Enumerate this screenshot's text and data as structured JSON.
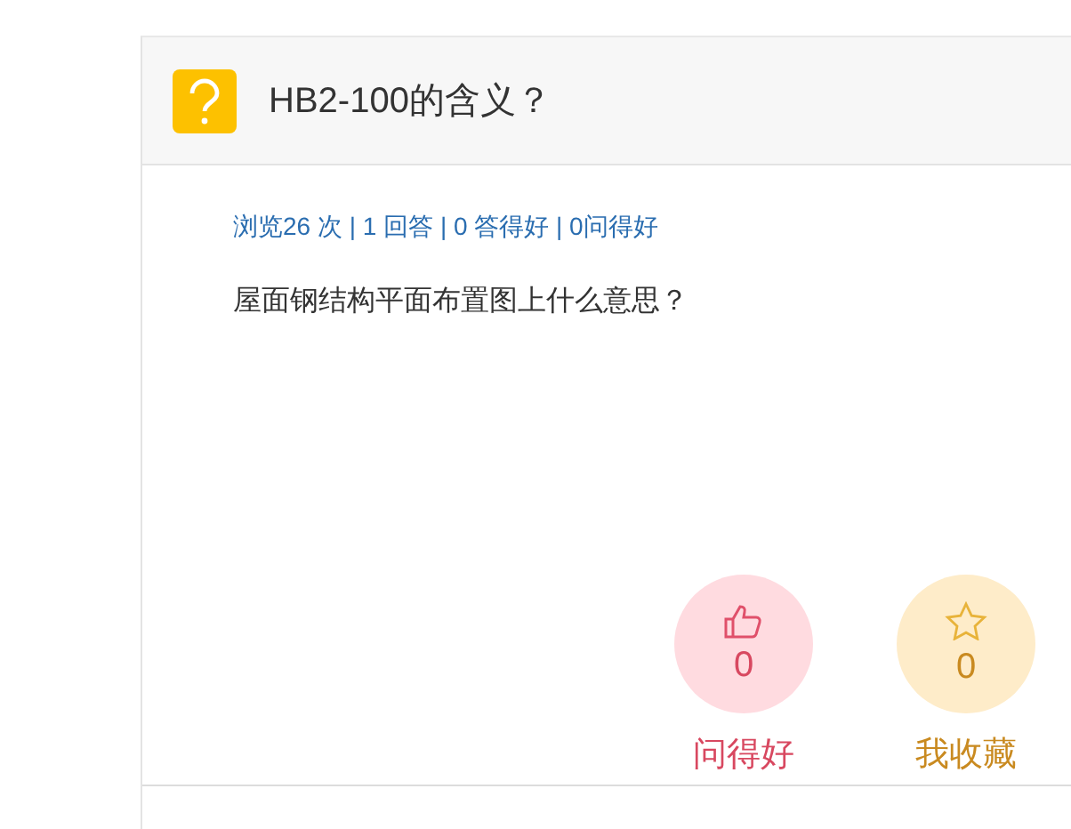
{
  "question": {
    "title": "HB2-100的含义？",
    "stats": "浏览26 次 | 1 回答 | 0 答得好 | 0问得好",
    "body": "屋面钢结构平面布置图上什么意思？"
  },
  "actions": [
    {
      "kind": "like",
      "count": "0",
      "label": "问得好"
    },
    {
      "kind": "favorite",
      "count": "0",
      "label": "我收藏"
    }
  ]
}
